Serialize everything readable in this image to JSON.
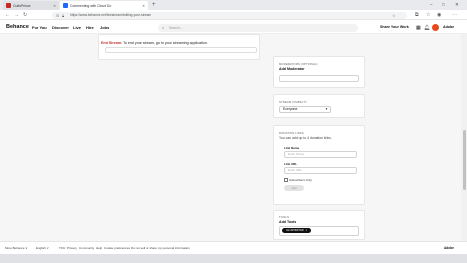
{
  "browser": {
    "tabs": [
      {
        "label": "CuttsPrince",
        "active": false
      },
      {
        "label": "Commenting with Cloud Do",
        "active": true
      }
    ],
    "url": "https://www.behance.net/livestream/editing-your-stream",
    "new_tab": "+",
    "controls": {
      "minimize": "–",
      "maximize": "□",
      "close": "✕"
    }
  },
  "header": {
    "logo": "Behance",
    "nav": [
      "For You",
      "Discover",
      "Live",
      "Hire",
      "Jobs"
    ],
    "search_placeholder": "Search...",
    "share_label": "Share Your Work",
    "adobe_label": "Adobe"
  },
  "notice": {
    "bold": "End Stream:",
    "text": " To end your stream, go to your streaming application."
  },
  "panels": {
    "moderators": {
      "label": "Moderators (optional)",
      "title": "Add Moderator"
    },
    "privacy": {
      "label": "Stream Visibility",
      "value": "Everyone"
    },
    "donation": {
      "label": "Donation Links",
      "subtitle": "You can add up to 4 donation links.",
      "link_name_label": "Link Name",
      "link_name_placeholder": "Enter Name",
      "link_url_label": "Link URL",
      "link_url_placeholder": "Enter URL",
      "subscribers_only": "Subscribers Only",
      "add_button": "Add"
    },
    "tools": {
      "label": "Tools",
      "title": "Add Tools",
      "tag": "ILLUSTRATOR",
      "tag_x": "×"
    }
  },
  "footer": {
    "language": "More Behance ∨",
    "region": "English ∨",
    "links": [
      "TOU",
      "Privacy",
      "Community",
      "Help",
      "Cookie preferences",
      "Do not sell or share my personal information"
    ],
    "adobe": "Adobe"
  }
}
